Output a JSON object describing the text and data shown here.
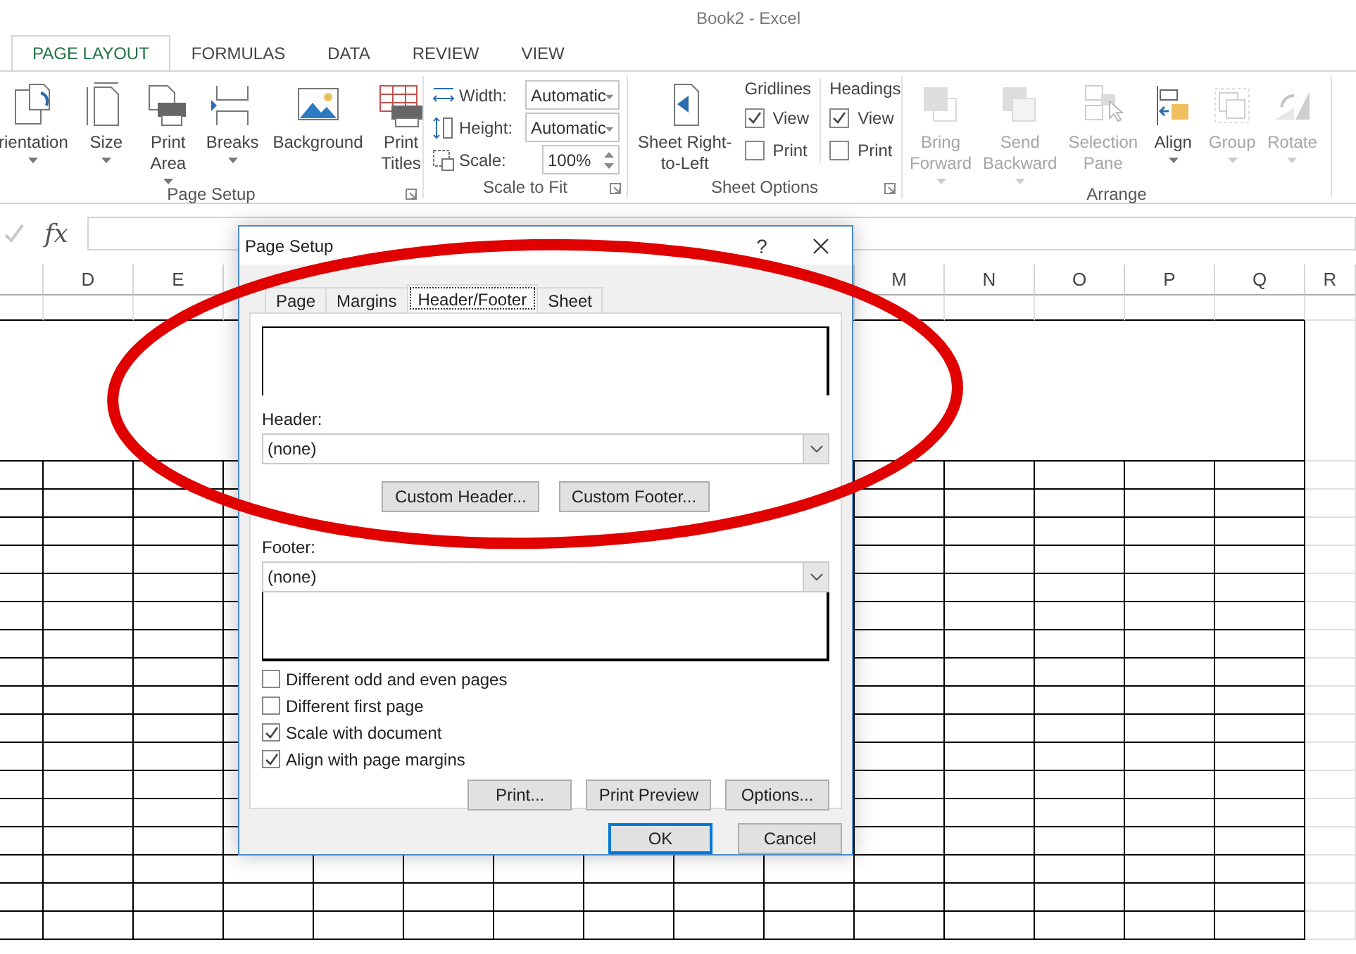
{
  "window": {
    "title": "Book2 - Excel"
  },
  "ribbon_tabs": [
    {
      "label": "PAGE LAYOUT",
      "selected": true
    },
    {
      "label": "FORMULAS",
      "selected": false
    },
    {
      "label": "DATA",
      "selected": false
    },
    {
      "label": "REVIEW",
      "selected": false
    },
    {
      "label": "VIEW",
      "selected": false
    }
  ],
  "page_setup": {
    "label": "Page Setup",
    "buttons": [
      {
        "lines": [
          "rientation"
        ],
        "dropdown": true
      },
      {
        "lines": [
          "Size"
        ],
        "dropdown": true
      },
      {
        "lines": [
          "Print",
          "Area"
        ],
        "dropdown": true
      },
      {
        "lines": [
          "Breaks"
        ],
        "dropdown": true
      },
      {
        "lines": [
          "Background"
        ],
        "dropdown": false
      },
      {
        "lines": [
          "Print",
          "Titles"
        ],
        "dropdown": false
      }
    ]
  },
  "scale_to_fit": {
    "label": "Scale to Fit",
    "rows": [
      {
        "kind": "dropdown",
        "label": "Width:",
        "value": "Automatic"
      },
      {
        "kind": "dropdown",
        "label": "Height:",
        "value": "Automatic"
      },
      {
        "kind": "spinner",
        "label": "Scale:",
        "value": "100%"
      }
    ]
  },
  "sheet_options": {
    "label": "Sheet Options",
    "direction_button": {
      "lines": [
        "Sheet Right-",
        "to-Left"
      ]
    },
    "sections": [
      {
        "title": "Gridlines",
        "options": [
          {
            "label": "View",
            "checked": true
          },
          {
            "label": "Print",
            "checked": false
          }
        ]
      },
      {
        "title": "Headings",
        "options": [
          {
            "label": "View",
            "checked": true
          },
          {
            "label": "Print",
            "checked": false
          }
        ]
      }
    ]
  },
  "arrange": {
    "label": "Arrange",
    "buttons": [
      {
        "lines": [
          "Bring",
          "Forward"
        ],
        "dropdown": true,
        "disabled": true
      },
      {
        "lines": [
          "Send",
          "Backward"
        ],
        "dropdown": true,
        "disabled": true
      },
      {
        "lines": [
          "Selection",
          "Pane"
        ],
        "dropdown": false,
        "disabled": true
      },
      {
        "lines": [
          "Align"
        ],
        "dropdown": true,
        "disabled": false
      },
      {
        "lines": [
          "Group"
        ],
        "dropdown": true,
        "disabled": true
      },
      {
        "lines": [
          "Rotate"
        ],
        "dropdown": true,
        "disabled": true
      }
    ]
  },
  "formula_bar": {
    "function_symbol": "fx"
  },
  "columns_left": [
    "D",
    "E"
  ],
  "columns_right": [
    "M",
    "N",
    "O",
    "P",
    "Q",
    "R"
  ],
  "dialog": {
    "title": "Page Setup",
    "help": "?",
    "tabs": [
      {
        "label": "Page",
        "selected": false
      },
      {
        "label": "Margins",
        "selected": false
      },
      {
        "label": "Header/Footer",
        "selected": true
      },
      {
        "label": "Sheet",
        "selected": false
      }
    ],
    "header_label": "Header:",
    "header_value": "(none)",
    "custom_buttons": [
      "Custom Header...",
      "Custom Footer..."
    ],
    "footer_label": "Footer:",
    "footer_value": "(none)",
    "options": [
      {
        "label": "Different odd and even pages",
        "checked": false
      },
      {
        "label": "Different first page",
        "checked": false
      },
      {
        "label": "Scale with document",
        "checked": true
      },
      {
        "label": "Align with page margins",
        "checked": true
      }
    ],
    "action_buttons": [
      "Print...",
      "Print Preview",
      "Options..."
    ],
    "footer_buttons": [
      {
        "label": "OK",
        "default": true
      },
      {
        "label": "Cancel",
        "default": false
      }
    ]
  }
}
